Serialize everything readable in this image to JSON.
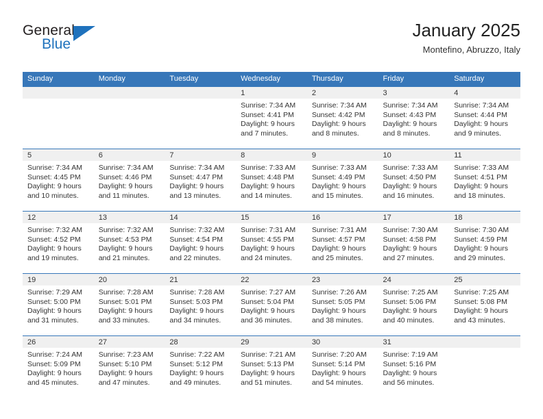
{
  "logo": {
    "name_part1": "General",
    "name_part2": "Blue",
    "triangle_icon": "blue-triangle-icon",
    "colors": {
      "text": "#231f20",
      "accent": "#1f72bd"
    }
  },
  "header": {
    "title": "January 2025",
    "subtitle": "Montefino, Abruzzo, Italy"
  },
  "colors": {
    "header_bar": "#3777b9",
    "daynum_strip": "#f0f0f0",
    "grid_line": "#3777b9",
    "text": "#333333"
  },
  "weekdays": [
    "Sunday",
    "Monday",
    "Tuesday",
    "Wednesday",
    "Thursday",
    "Friday",
    "Saturday"
  ],
  "weeks": [
    [
      {
        "day": "",
        "lines": []
      },
      {
        "day": "",
        "lines": []
      },
      {
        "day": "",
        "lines": []
      },
      {
        "day": "1",
        "lines": [
          "Sunrise: 7:34 AM",
          "Sunset: 4:41 PM",
          "Daylight: 9 hours",
          "and 7 minutes."
        ]
      },
      {
        "day": "2",
        "lines": [
          "Sunrise: 7:34 AM",
          "Sunset: 4:42 PM",
          "Daylight: 9 hours",
          "and 8 minutes."
        ]
      },
      {
        "day": "3",
        "lines": [
          "Sunrise: 7:34 AM",
          "Sunset: 4:43 PM",
          "Daylight: 9 hours",
          "and 8 minutes."
        ]
      },
      {
        "day": "4",
        "lines": [
          "Sunrise: 7:34 AM",
          "Sunset: 4:44 PM",
          "Daylight: 9 hours",
          "and 9 minutes."
        ]
      }
    ],
    [
      {
        "day": "5",
        "lines": [
          "Sunrise: 7:34 AM",
          "Sunset: 4:45 PM",
          "Daylight: 9 hours",
          "and 10 minutes."
        ]
      },
      {
        "day": "6",
        "lines": [
          "Sunrise: 7:34 AM",
          "Sunset: 4:46 PM",
          "Daylight: 9 hours",
          "and 11 minutes."
        ]
      },
      {
        "day": "7",
        "lines": [
          "Sunrise: 7:34 AM",
          "Sunset: 4:47 PM",
          "Daylight: 9 hours",
          "and 13 minutes."
        ]
      },
      {
        "day": "8",
        "lines": [
          "Sunrise: 7:33 AM",
          "Sunset: 4:48 PM",
          "Daylight: 9 hours",
          "and 14 minutes."
        ]
      },
      {
        "day": "9",
        "lines": [
          "Sunrise: 7:33 AM",
          "Sunset: 4:49 PM",
          "Daylight: 9 hours",
          "and 15 minutes."
        ]
      },
      {
        "day": "10",
        "lines": [
          "Sunrise: 7:33 AM",
          "Sunset: 4:50 PM",
          "Daylight: 9 hours",
          "and 16 minutes."
        ]
      },
      {
        "day": "11",
        "lines": [
          "Sunrise: 7:33 AM",
          "Sunset: 4:51 PM",
          "Daylight: 9 hours",
          "and 18 minutes."
        ]
      }
    ],
    [
      {
        "day": "12",
        "lines": [
          "Sunrise: 7:32 AM",
          "Sunset: 4:52 PM",
          "Daylight: 9 hours",
          "and 19 minutes."
        ]
      },
      {
        "day": "13",
        "lines": [
          "Sunrise: 7:32 AM",
          "Sunset: 4:53 PM",
          "Daylight: 9 hours",
          "and 21 minutes."
        ]
      },
      {
        "day": "14",
        "lines": [
          "Sunrise: 7:32 AM",
          "Sunset: 4:54 PM",
          "Daylight: 9 hours",
          "and 22 minutes."
        ]
      },
      {
        "day": "15",
        "lines": [
          "Sunrise: 7:31 AM",
          "Sunset: 4:55 PM",
          "Daylight: 9 hours",
          "and 24 minutes."
        ]
      },
      {
        "day": "16",
        "lines": [
          "Sunrise: 7:31 AM",
          "Sunset: 4:57 PM",
          "Daylight: 9 hours",
          "and 25 minutes."
        ]
      },
      {
        "day": "17",
        "lines": [
          "Sunrise: 7:30 AM",
          "Sunset: 4:58 PM",
          "Daylight: 9 hours",
          "and 27 minutes."
        ]
      },
      {
        "day": "18",
        "lines": [
          "Sunrise: 7:30 AM",
          "Sunset: 4:59 PM",
          "Daylight: 9 hours",
          "and 29 minutes."
        ]
      }
    ],
    [
      {
        "day": "19",
        "lines": [
          "Sunrise: 7:29 AM",
          "Sunset: 5:00 PM",
          "Daylight: 9 hours",
          "and 31 minutes."
        ]
      },
      {
        "day": "20",
        "lines": [
          "Sunrise: 7:28 AM",
          "Sunset: 5:01 PM",
          "Daylight: 9 hours",
          "and 33 minutes."
        ]
      },
      {
        "day": "21",
        "lines": [
          "Sunrise: 7:28 AM",
          "Sunset: 5:03 PM",
          "Daylight: 9 hours",
          "and 34 minutes."
        ]
      },
      {
        "day": "22",
        "lines": [
          "Sunrise: 7:27 AM",
          "Sunset: 5:04 PM",
          "Daylight: 9 hours",
          "and 36 minutes."
        ]
      },
      {
        "day": "23",
        "lines": [
          "Sunrise: 7:26 AM",
          "Sunset: 5:05 PM",
          "Daylight: 9 hours",
          "and 38 minutes."
        ]
      },
      {
        "day": "24",
        "lines": [
          "Sunrise: 7:25 AM",
          "Sunset: 5:06 PM",
          "Daylight: 9 hours",
          "and 40 minutes."
        ]
      },
      {
        "day": "25",
        "lines": [
          "Sunrise: 7:25 AM",
          "Sunset: 5:08 PM",
          "Daylight: 9 hours",
          "and 43 minutes."
        ]
      }
    ],
    [
      {
        "day": "26",
        "lines": [
          "Sunrise: 7:24 AM",
          "Sunset: 5:09 PM",
          "Daylight: 9 hours",
          "and 45 minutes."
        ]
      },
      {
        "day": "27",
        "lines": [
          "Sunrise: 7:23 AM",
          "Sunset: 5:10 PM",
          "Daylight: 9 hours",
          "and 47 minutes."
        ]
      },
      {
        "day": "28",
        "lines": [
          "Sunrise: 7:22 AM",
          "Sunset: 5:12 PM",
          "Daylight: 9 hours",
          "and 49 minutes."
        ]
      },
      {
        "day": "29",
        "lines": [
          "Sunrise: 7:21 AM",
          "Sunset: 5:13 PM",
          "Daylight: 9 hours",
          "and 51 minutes."
        ]
      },
      {
        "day": "30",
        "lines": [
          "Sunrise: 7:20 AM",
          "Sunset: 5:14 PM",
          "Daylight: 9 hours",
          "and 54 minutes."
        ]
      },
      {
        "day": "31",
        "lines": [
          "Sunrise: 7:19 AM",
          "Sunset: 5:16 PM",
          "Daylight: 9 hours",
          "and 56 minutes."
        ]
      },
      {
        "day": "",
        "lines": []
      }
    ]
  ]
}
